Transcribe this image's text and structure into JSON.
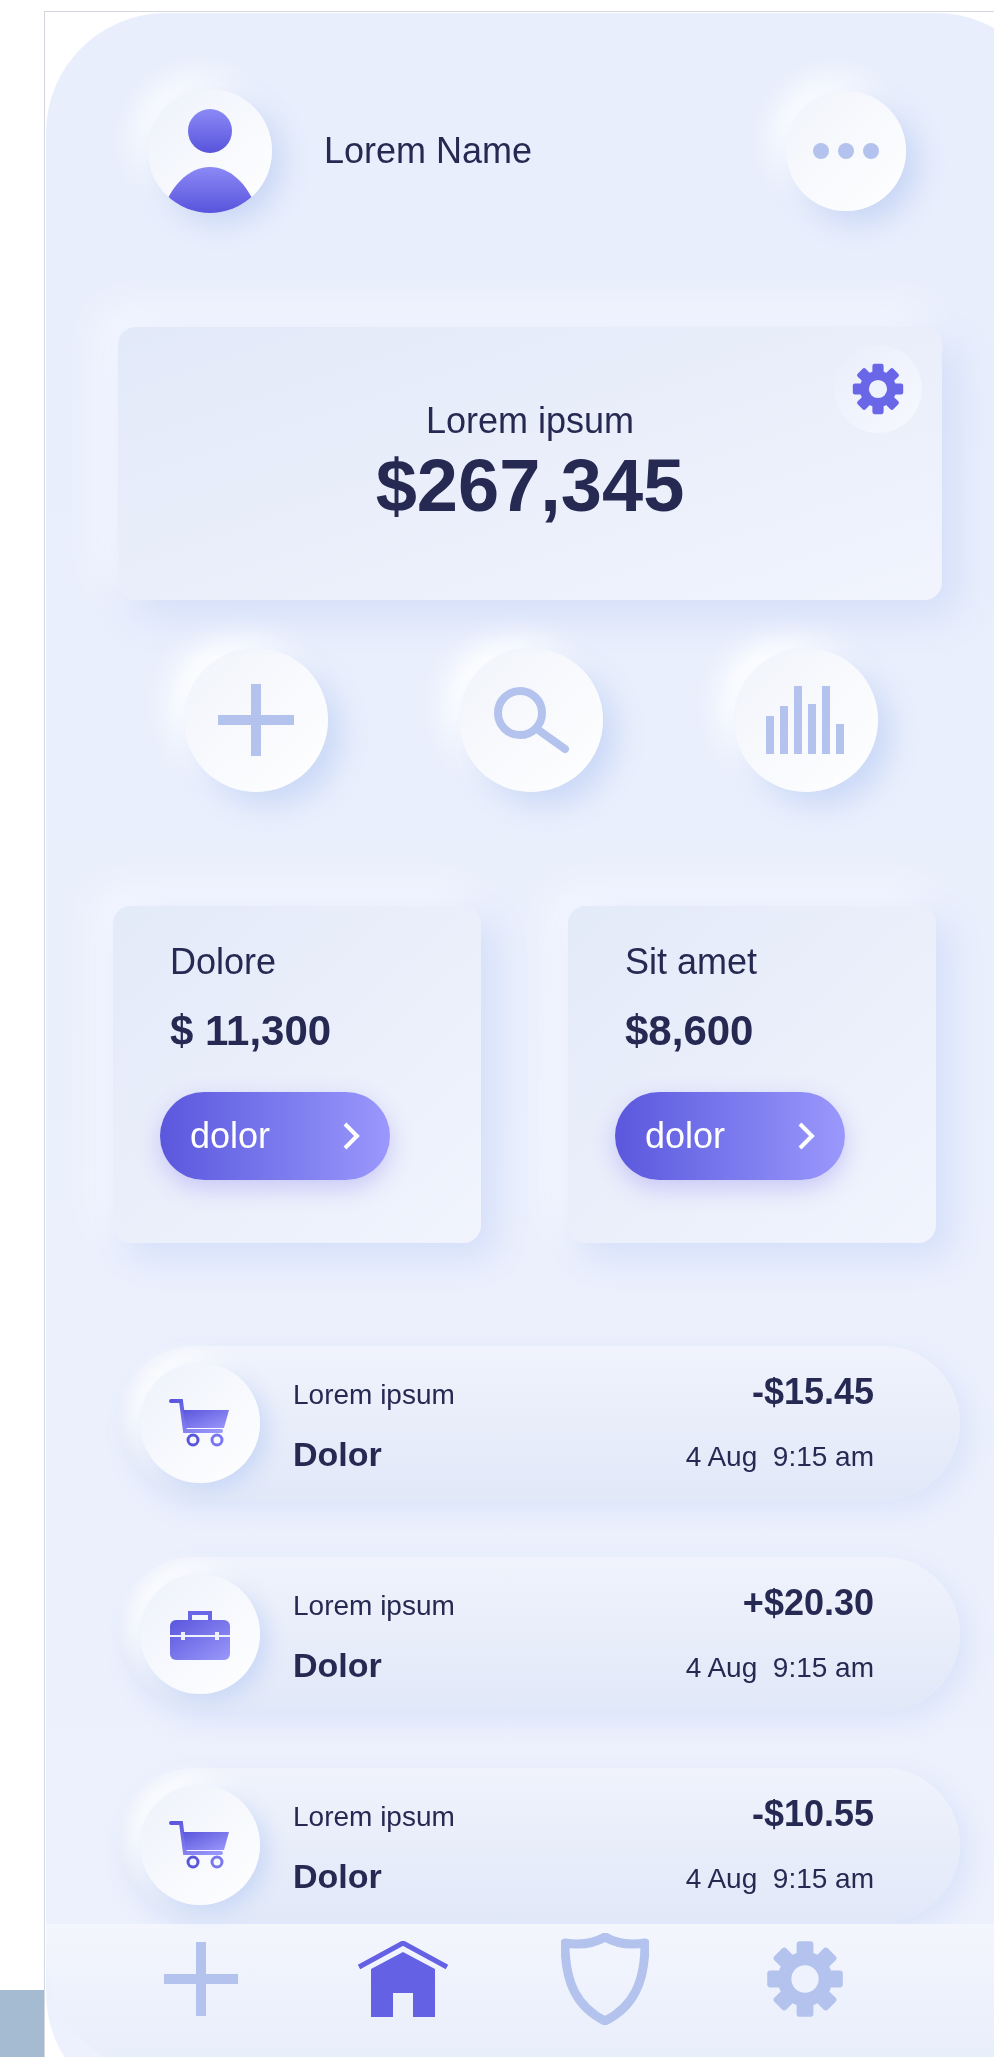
{
  "header": {
    "name": "Lorem Name"
  },
  "balance": {
    "label": "Lorem ipsum",
    "amount": "$267,345"
  },
  "actions": [
    {
      "kind": "plus"
    },
    {
      "kind": "search"
    },
    {
      "kind": "chart"
    }
  ],
  "cards": [
    {
      "label": "Dolore",
      "amount": "$ 11,300",
      "button": "dolor"
    },
    {
      "label": "Sit amet",
      "amount": "$8,600",
      "button": "dolor"
    }
  ],
  "transactions": [
    {
      "kind": "cart",
      "title": "Lorem ipsum",
      "subtitle": "Dolor",
      "amount": "-$15.45",
      "time": "4 Aug  9:15 am"
    },
    {
      "kind": "briefcase",
      "title": "Lorem ipsum",
      "subtitle": "Dolor",
      "amount": "+$20.30",
      "time": "4 Aug  9:15 am"
    },
    {
      "kind": "cart",
      "title": "Lorem ipsum",
      "subtitle": "Dolor",
      "amount": "-$10.55",
      "time": "4 Aug  9:15 am"
    }
  ],
  "nav": [
    {
      "kind": "plus",
      "selected": false
    },
    {
      "kind": "home",
      "selected": true
    },
    {
      "kind": "shield",
      "selected": false
    },
    {
      "kind": "gear",
      "selected": false
    }
  ]
}
